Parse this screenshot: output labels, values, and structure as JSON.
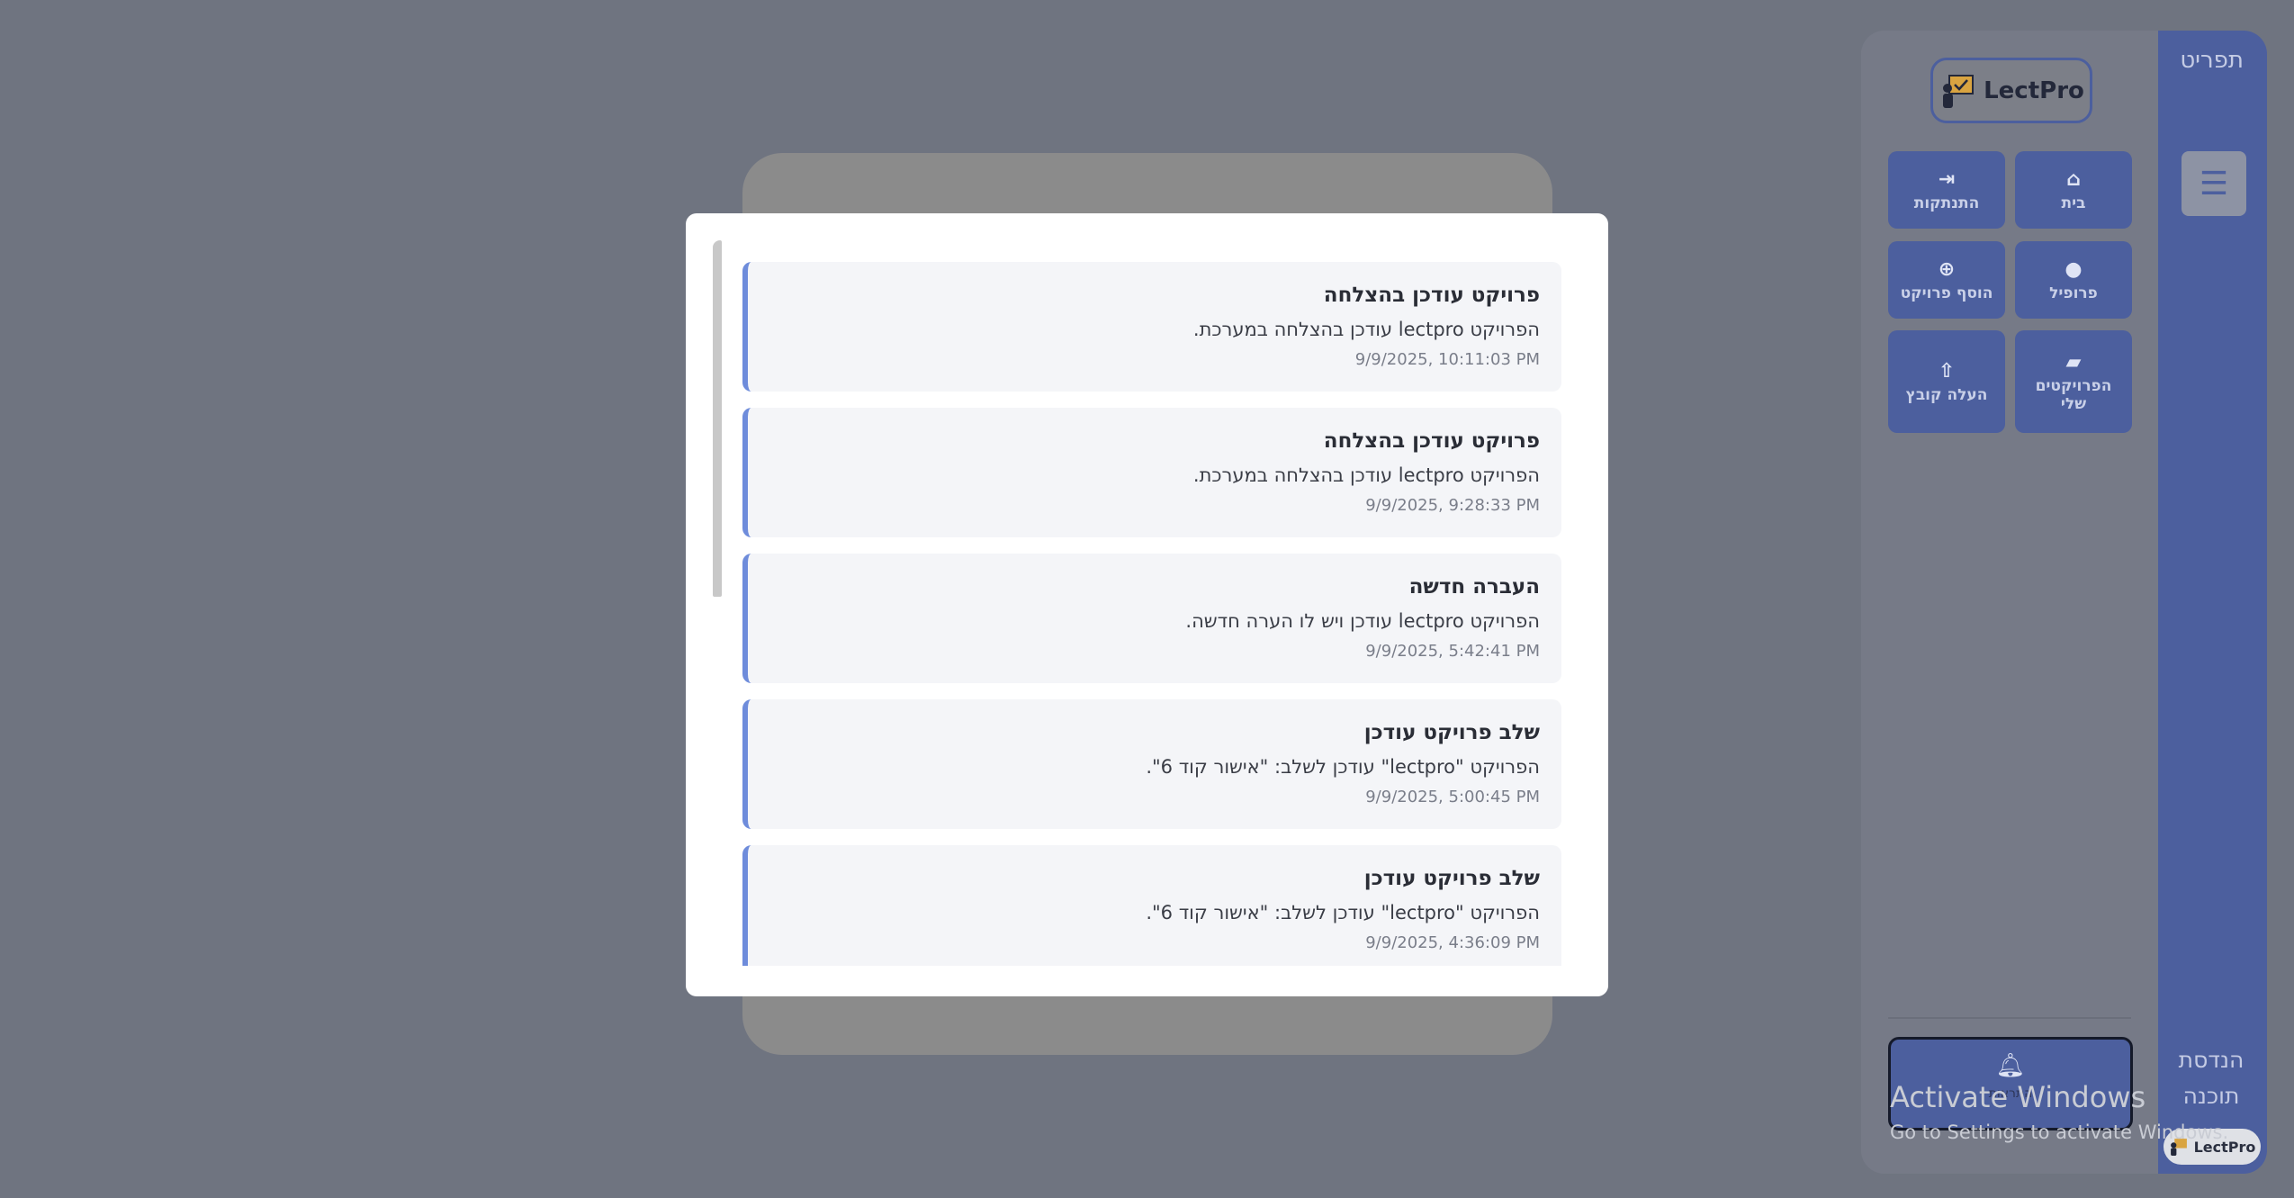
{
  "sidebar": {
    "brand": "תפריט",
    "toggle_glyph": "☰",
    "logo_text": "LectPro",
    "buttons": {
      "home": "בית",
      "logout": "התנתקות",
      "profile": "פרופיל",
      "add_project": "הוסף פרויקט",
      "my_projects": "הפרויקטים שלי",
      "upload_file": "העלה קובץ"
    },
    "notifications_label": "התראות",
    "footer_line1": "הנדסת",
    "footer_line2": "תוכנה",
    "footer_logo": "LectPro"
  },
  "modal": {
    "close_glyph": "✕",
    "notifications": [
      {
        "title": "פרויקט עודכן בהצלחה",
        "message": "הפרויקט lectpro עודכן בהצלחה במערכת.",
        "time": "9/9/2025, 10:11:03 PM"
      },
      {
        "title": "פרויקט עודכן בהצלחה",
        "message": "הפרויקט lectpro עודכן בהצלחה במערכת.",
        "time": "9/9/2025, 9:28:33 PM"
      },
      {
        "title": "העברה חדשה",
        "message": "הפרויקט lectpro עודכן ויש לו הערה חדשה.",
        "time": "9/9/2025, 5:42:41 PM"
      },
      {
        "title": "שלב פרויקט עודכן",
        "message": "הפרויקט \"lectpro\" עודכן לשלב: \"אישור קוד 6\".",
        "time": "9/9/2025, 5:00:45 PM"
      },
      {
        "title": "שלב פרויקט עודכן",
        "message": "הפרויקט \"lectpro\" עודכן לשלב: \"אישור קוד 6\".",
        "time": "9/9/2025, 4:36:09 PM"
      }
    ]
  },
  "watermark": {
    "line1": "Activate Windows",
    "line2": "Go to Settings to activate Windows."
  },
  "colors": {
    "accent": "#6e8cdb",
    "sidebar": "#4c5f9e",
    "overlay": "#6f7480"
  }
}
